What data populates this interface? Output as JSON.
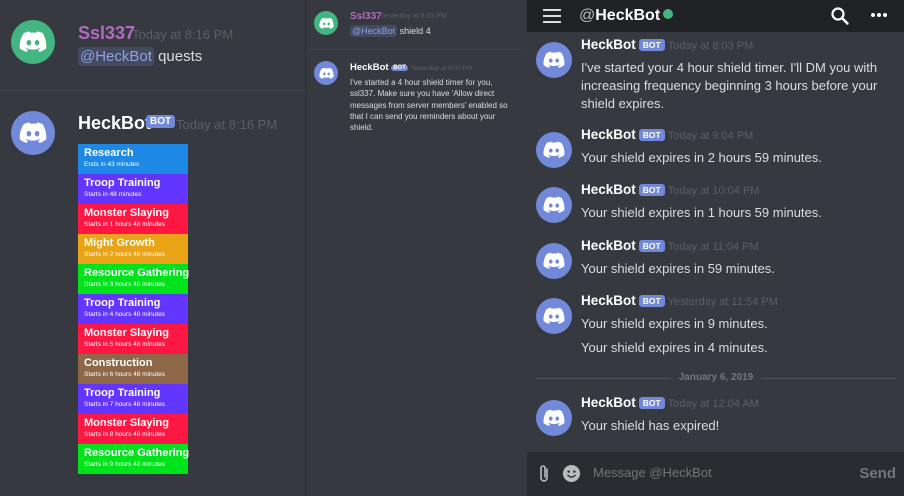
{
  "left_panel": {
    "user_name": "Ssl337",
    "user_time": "Today at 8:16 PM",
    "user_mention": "@HeckBot",
    "user_message": "quests",
    "bot_name": "HeckBot",
    "bot_badge": "BOT",
    "bot_time": "Today at 8:16 PM",
    "quests": [
      {
        "name": "Research",
        "status": "Ends in 43 minutes",
        "color": "#1e88e5"
      },
      {
        "name": "Troop Training",
        "status": "Starts in 48 minutes",
        "color": "#6236ff"
      },
      {
        "name": "Monster Slaying",
        "status": "Starts in 1 hours 48 minutes",
        "color": "#ff1744"
      },
      {
        "name": "Might Growth",
        "status": "Starts in 2 hours 48 minutes",
        "color": "#e8a317"
      },
      {
        "name": "Resource Gathering",
        "status": "Starts in 3 hours 48 minutes",
        "color": "#00e31c"
      },
      {
        "name": "Troop Training",
        "status": "Starts in 4 hours 48 minutes",
        "color": "#6236ff"
      },
      {
        "name": "Monster Slaying",
        "status": "Starts in 5 hours 48 minutes",
        "color": "#ff1744"
      },
      {
        "name": "Construction",
        "status": "Starts in 6 hours 48 minutes",
        "color": "#8d6748"
      },
      {
        "name": "Troop Training",
        "status": "Starts in 7 hours 48 minutes",
        "color": "#6236ff"
      },
      {
        "name": "Monster Slaying",
        "status": "Starts in 8 hours 48 minutes",
        "color": "#ff1744"
      },
      {
        "name": "Resource Gathering",
        "status": "Starts in 9 hours 48 minutes",
        "color": "#00e31c"
      }
    ]
  },
  "middle_panel": {
    "user_name": "Ssl337",
    "user_time": "Yesterday at 8:03 PM",
    "user_mention": "@HeckBot",
    "user_message": "shield 4",
    "bot_name": "HeckBot",
    "bot_badge": "BOT",
    "bot_time": "Yesterday at 8:03 PM",
    "bot_message": "I've started a 4 hour shield timer for you, ssl337.  Make sure you have 'Allow direct messages from server members' enabled so that I can send you reminders about your shield."
  },
  "right_panel": {
    "header_at": "@",
    "header_title": "HeckBot",
    "messages": [
      {
        "name": "HeckBot",
        "badge": "BOT",
        "time": "Today at 8:03 PM",
        "lines": [
          "I've started your 4 hour shield timer.  I'll DM you with increasing frequency beginning 3 hours before your shield expires."
        ]
      },
      {
        "name": "HeckBot",
        "badge": "BOT",
        "time": "Today at 9:04 PM",
        "lines": [
          "Your shield expires in 2 hours 59 minutes."
        ]
      },
      {
        "name": "HeckBot",
        "badge": "BOT",
        "time": "Today at 10:04 PM",
        "lines": [
          "Your shield expires in 1 hours 59 minutes."
        ]
      },
      {
        "name": "HeckBot",
        "badge": "BOT",
        "time": "Today at 11:04 PM",
        "lines": [
          "Your shield expires in 59 minutes."
        ]
      },
      {
        "name": "HeckBot",
        "badge": "BOT",
        "time": "Yesterday at 11:54 PM",
        "lines": [
          "Your shield expires in 9 minutes.",
          "Your shield expires in 4 minutes."
        ]
      },
      {
        "name": "HeckBot",
        "badge": "BOT",
        "time": "Today at 12:04 AM",
        "lines": [
          "Your shield has expired!"
        ]
      }
    ],
    "date_divider": "January 6, 2019",
    "input_placeholder": "Message @HeckBot",
    "send_label": "Send"
  }
}
